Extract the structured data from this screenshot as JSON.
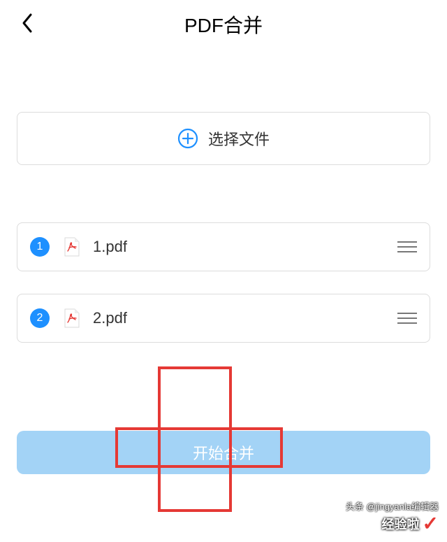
{
  "header": {
    "title": "PDF合并"
  },
  "selectFile": {
    "label": "选择文件"
  },
  "files": [
    {
      "index": "1",
      "name": "1.pdf"
    },
    {
      "index": "2",
      "name": "2.pdf"
    }
  ],
  "startBtn": {
    "label": "开始合并"
  },
  "watermark": {
    "small": "头条 @jingyanla编辑器",
    "main": "经验啦"
  }
}
